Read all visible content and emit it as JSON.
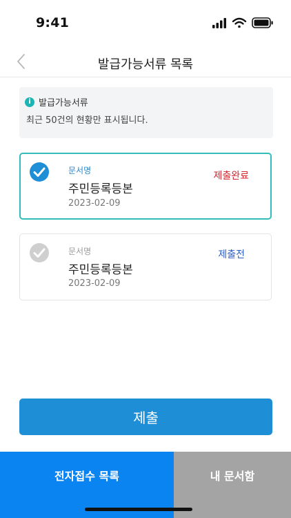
{
  "status_bar": {
    "time": "9:41",
    "icons": [
      "signal-icon",
      "wifi-icon",
      "battery-icon"
    ]
  },
  "nav": {
    "title": "발급가능서류 목록",
    "back_icon": "chevron-left-icon"
  },
  "info": {
    "icon": "info-icon",
    "icon_glyph": "i",
    "title": "발급가능서류",
    "text": "최근 50건의 현황만 표시됩니다."
  },
  "documents": [
    {
      "label": "문서명",
      "name": "주민등록등본",
      "date": "2023-02-09",
      "status": "제출완료",
      "checked": true
    },
    {
      "label": "문서명",
      "name": "주민등록등본",
      "date": "2023-02-09",
      "status": "제출전",
      "checked": false
    }
  ],
  "submit_label": "제출",
  "tabs": [
    {
      "label": "전자접수 목록",
      "active": true
    },
    {
      "label": "내 문서함",
      "active": false
    }
  ],
  "colors": {
    "accent": "#1e8ed6",
    "selected_border": "#33bdb9",
    "status_done": "#d1262e",
    "status_pending": "#2d5ec7",
    "tab_active": "#0a84f0",
    "tab_inactive": "#a4a4a4"
  }
}
